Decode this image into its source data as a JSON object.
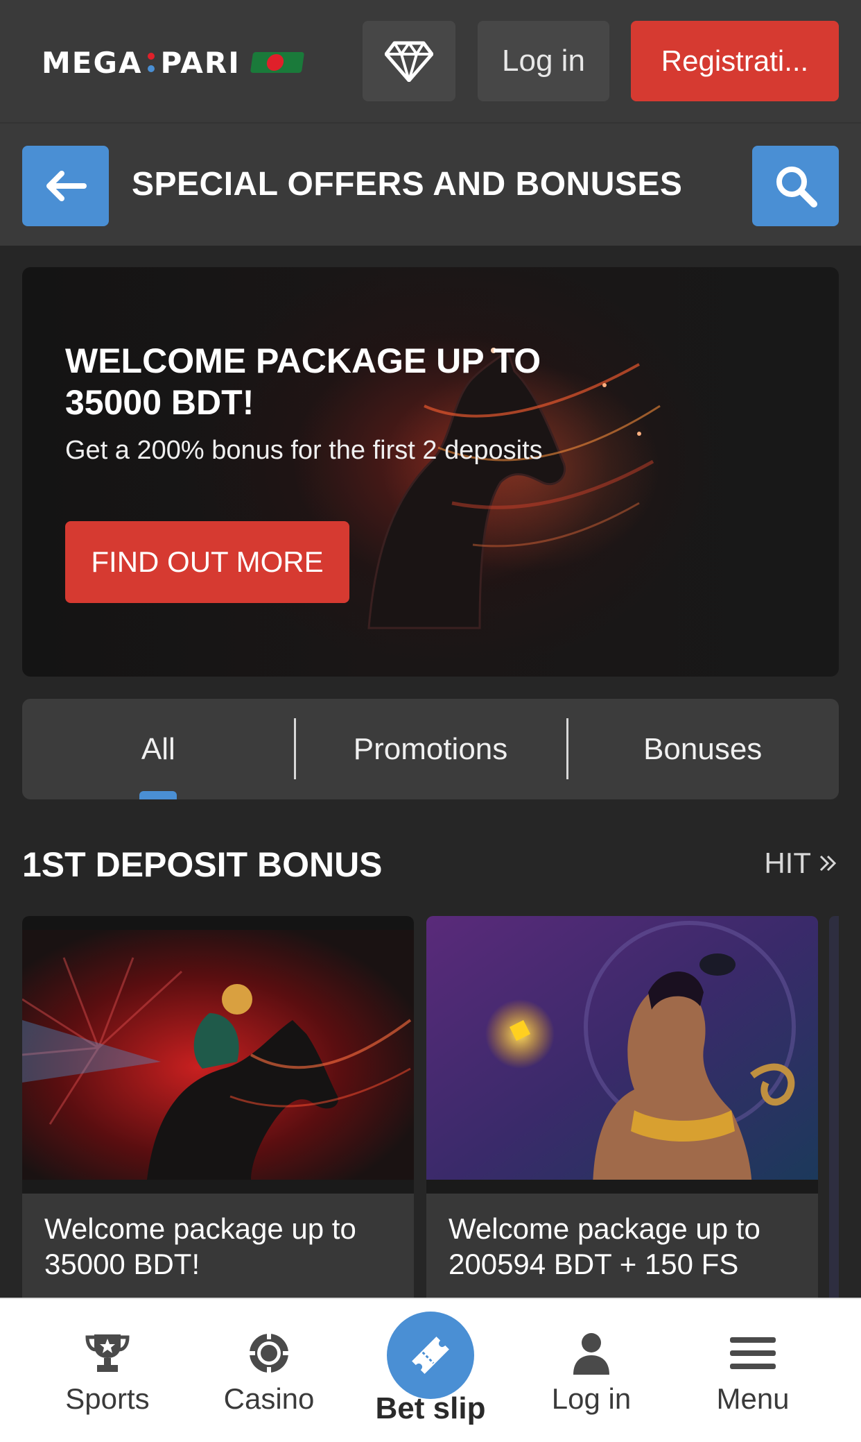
{
  "header": {
    "logo": {
      "left": "MEGA",
      "right": "PARI",
      "colon_colors": [
        "#e0202a",
        "#4a8fd4"
      ]
    },
    "login_label": "Log in",
    "register_label": "Registrati..."
  },
  "titlebar": {
    "title": "SPECIAL OFFERS AND BONUSES"
  },
  "banner": {
    "title": "WELCOME PACKAGE UP TO 35000 BDT!",
    "subtitle": "Get a 200% bonus for the first 2 deposits",
    "button_label": "FIND OUT MORE"
  },
  "tabs": [
    {
      "label": "All",
      "active": true
    },
    {
      "label": "Promotions",
      "active": false
    },
    {
      "label": "Bonuses",
      "active": false
    }
  ],
  "section": {
    "title": "1ST DEPOSIT BONUS",
    "link_label": "HIT",
    "link_icon": "double-chevron-right-icon"
  },
  "cards": [
    {
      "text": "Welcome package up to 35000 BDT!",
      "image": "jockey-horse"
    },
    {
      "text": "Welcome package up to 200594 BDT + 150 FS",
      "image": "egyptian-queen"
    }
  ],
  "bottom_nav": {
    "sports": "Sports",
    "casino": "Casino",
    "betslip": "Bet slip",
    "login": "Log in",
    "menu": "Menu"
  },
  "colors": {
    "accent_red": "#d63a31",
    "accent_blue": "#4a8fd4",
    "bg_dark": "#262626",
    "panel": "#3a3a3a"
  }
}
